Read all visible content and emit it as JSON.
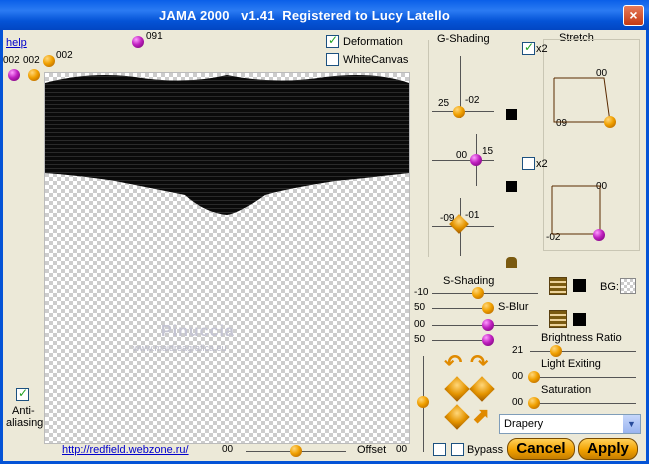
{
  "window": {
    "title": "JAMA 2000   v1.41  Registered to Lucy Latello",
    "close_glyph": "×"
  },
  "left": {
    "help_label": "help",
    "top_values": {
      "a": "002",
      "b": "002",
      "c": "002",
      "d": "091"
    },
    "antialias_label_1": "Anti-",
    "antialias_label_2": "aliasing",
    "url": "http://redfield.webzone.ru/"
  },
  "options": {
    "deformation": "Deformation",
    "whitecanvas": "WhiteCanvas"
  },
  "preview": {
    "watermark_1": "Pinuccia",
    "watermark_2": "www.maidreagrafica.eu"
  },
  "gshading": {
    "title": "G-Shading",
    "c1": {
      "x": "25",
      "y": "-02"
    },
    "c2": {
      "x": "00",
      "y": "15"
    },
    "c3": {
      "x": "-09",
      "y": "-01"
    }
  },
  "stretch": {
    "title": "Stretch",
    "x2_label": "x2",
    "box1": {
      "top": "00",
      "left": "09"
    },
    "box2": {
      "top": "00",
      "left": "-02"
    }
  },
  "sshading": {
    "title": "S-Shading",
    "rows": [
      {
        "value": "-10",
        "label": ""
      },
      {
        "value": "50",
        "label": "S-Blur"
      },
      {
        "value": "00",
        "label": ""
      },
      {
        "value": "50",
        "label": ""
      }
    ],
    "bg_label": "BG:"
  },
  "right_sliders": {
    "brightness": {
      "label": "Brightness Ratio",
      "value": "21"
    },
    "light": {
      "label": "Light Exiting",
      "value": "00"
    },
    "saturation": {
      "label": "Saturation",
      "value": "00"
    }
  },
  "bottom": {
    "offset_value_left": "00",
    "offset_label": "Offset",
    "offset_value_right": "00",
    "bypass_label": "Bypass",
    "cancel_label": "Cancel",
    "apply_label": "Apply",
    "preset_value": "Drapery",
    "dropdown_glyph": "▼"
  }
}
